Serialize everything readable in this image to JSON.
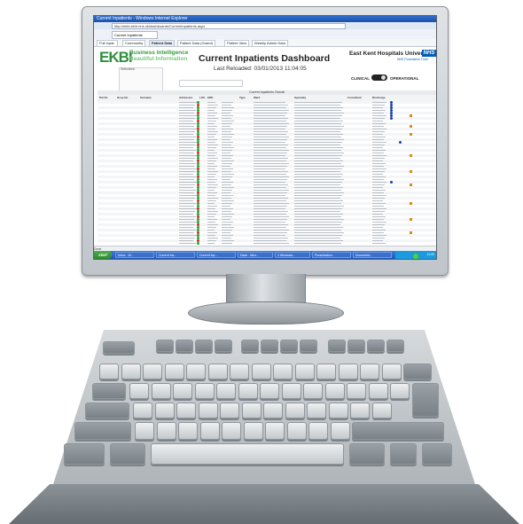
{
  "browser": {
    "title": "Current Inpatients - Windows Internet Explorer",
    "address": "http://ekbi.ekht.nhs.uk/dashboards/CurrentInpatients.aspx",
    "favorite_tab": "Current Inpatients",
    "nav_tabs": [
      "Full Inpat.",
      "Community",
      "Patient Data",
      "Patient Data (Grand)",
      "Patient View",
      "Weekly Admin Data"
    ]
  },
  "header": {
    "logo": "EKBI",
    "logo_sub1": "Business Intelligence",
    "logo_sub2": "Beautiful Information",
    "title": "Current Inpatients Dashboard",
    "last_reloaded": "Last Reloaded: 03/01/2013 11:04:05",
    "trust": "East Kent Hospitals University",
    "nhs": "NHS",
    "trust_sub": "NHS Foundation Trust",
    "toggle_left": "CLINICAL",
    "toggle_right": "OPERATIONAL",
    "filters_label": "Selections"
  },
  "table": {
    "caption": "Current Inpatients Overall",
    "columns": [
      "Pat No",
      "Hosp No",
      "Surname",
      "Admission",
      "LOS",
      "EDD",
      "Type",
      "Ward",
      "Specialty",
      "Consultant",
      "Discharge"
    ]
  },
  "colors": {
    "green": "#2aa02a",
    "red": "#d42a2a",
    "blue": "#1a3fb0",
    "orange": "#e08a10"
  },
  "taskbar": {
    "start": "start",
    "tasks": [
      "Inbox - M...",
      "Current Ins...",
      "Current Inp...",
      "Dash - Micr...",
      "2 Windows...",
      "Presentation...",
      "Document..."
    ],
    "tray": "11:09"
  },
  "statusbar": "Done"
}
